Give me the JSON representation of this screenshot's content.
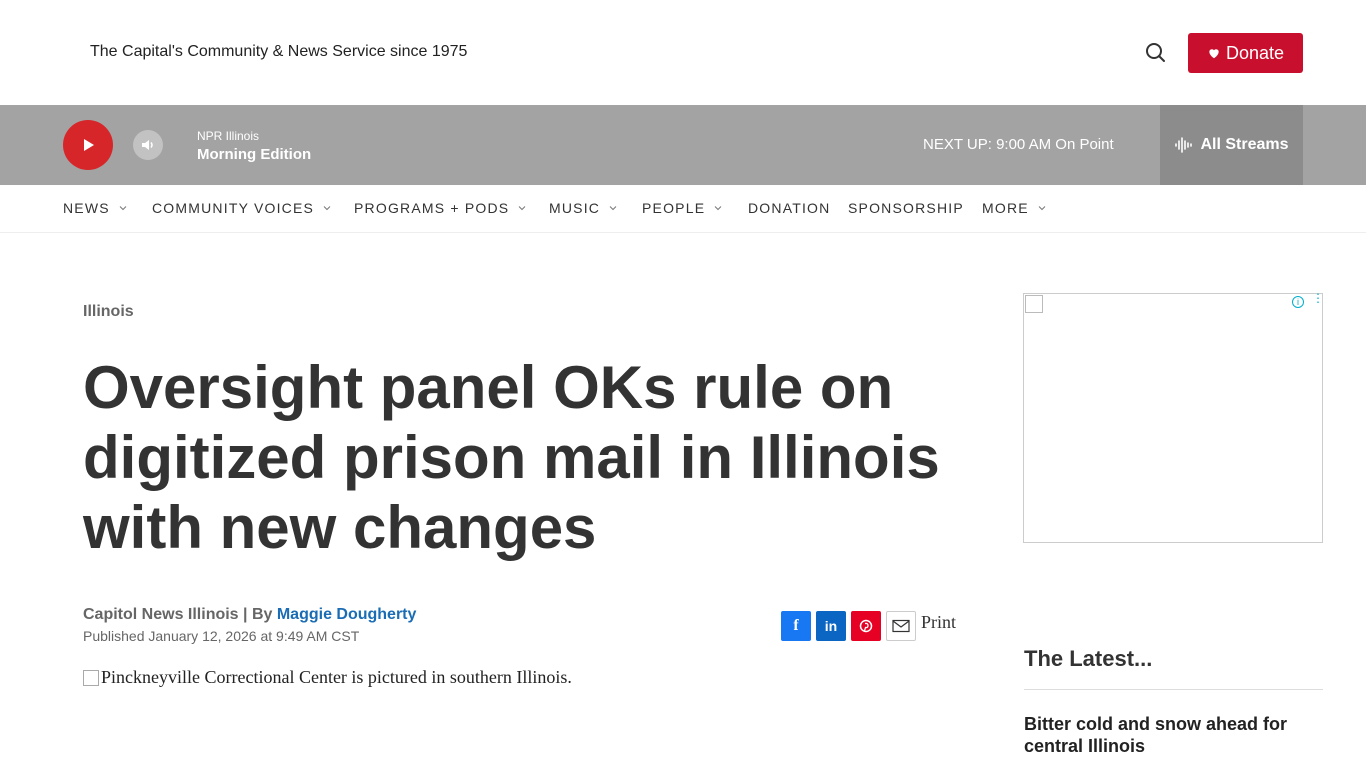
{
  "header": {
    "tagline": "The Capital's Community & News Service since 1975",
    "donate_label": "Donate"
  },
  "player": {
    "station": "NPR Illinois",
    "show": "Morning Edition",
    "next_up": "NEXT UP: 9:00 AM On Point",
    "all_streams_label": "All Streams"
  },
  "nav": {
    "items": [
      {
        "label": "NEWS",
        "has_dropdown": true
      },
      {
        "label": "COMMUNITY VOICES",
        "has_dropdown": true
      },
      {
        "label": "PROGRAMS + PODS",
        "has_dropdown": true
      },
      {
        "label": "MUSIC",
        "has_dropdown": true
      },
      {
        "label": "PEOPLE",
        "has_dropdown": true
      },
      {
        "label": "DONATION",
        "has_dropdown": false
      },
      {
        "label": "SPONSORSHIP",
        "has_dropdown": false
      },
      {
        "label": "MORE",
        "has_dropdown": true
      }
    ]
  },
  "article": {
    "kicker": "Illinois",
    "headline": "Oversight panel OKs rule on digitized prison mail in Illinois with new changes",
    "source": "Capitol News Illinois | By ",
    "author": "Maggie Dougherty",
    "published": "Published January 12, 2026 at 9:49 AM CST",
    "print_label": "Print",
    "image_alt": "Pinckneyville Correctional Center is pictured in southern Illinois."
  },
  "sidebar": {
    "latest_heading": "The Latest...",
    "latest_items": [
      {
        "title": "Bitter cold and snow ahead for central Illinois"
      }
    ]
  },
  "colors": {
    "donate": "#c8102e",
    "player_bg": "#a3a3a3",
    "all_streams_bg": "#8c8c8c",
    "play_button": "#d7262a",
    "author_link": "#1a6db5",
    "facebook": "#1877f2",
    "linkedin": "#0a66c2",
    "pinterest": "#e60023"
  },
  "icons": {
    "search": "search-icon",
    "heart": "heart-icon",
    "play": "play-icon",
    "volume": "volume-icon",
    "streams": "audio-wave-icon",
    "chevron": "chevron-down-icon",
    "facebook": "facebook-icon",
    "linkedin": "linkedin-icon",
    "pinterest": "pinterest-icon",
    "email": "email-icon"
  }
}
